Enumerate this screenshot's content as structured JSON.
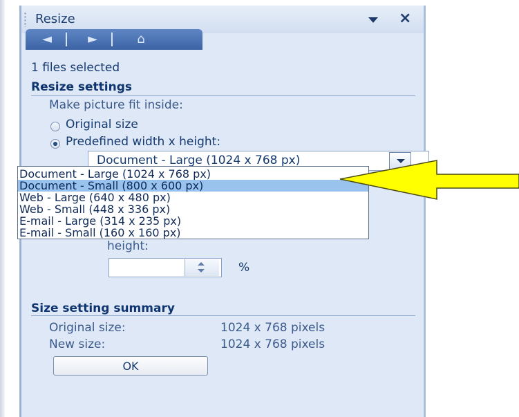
{
  "panel": {
    "title": "Resize",
    "nav_back_icon": "◄",
    "nav_forward_icon": "►",
    "nav_home_icon": "⌂"
  },
  "selection": {
    "status": "1 files selected"
  },
  "resize_settings": {
    "heading": "Resize settings",
    "fit_label": "Make picture fit inside:",
    "options": [
      {
        "label": "Original size",
        "selected": false
      },
      {
        "label": "Predefined width x height:",
        "selected": true
      }
    ],
    "combo_value": "Document - Large (1024 x 768 px)",
    "dropdown_items": [
      {
        "label": "Document - Large (1024 x 768 px)",
        "highlighted": false
      },
      {
        "label": "Document - Small (800 x 600 px)",
        "highlighted": true
      },
      {
        "label": "Web - Large (640 x 480 px)",
        "highlighted": false
      },
      {
        "label": "Web - Small (448 x 336 px)",
        "highlighted": false
      },
      {
        "label": "E-mail - Large (314 x 235 px)",
        "highlighted": false
      },
      {
        "label": "E-mail - Small (160 x 160 px)",
        "highlighted": false
      }
    ],
    "height_label": "height:",
    "height_value": "",
    "percent_unit": "%"
  },
  "summary": {
    "heading": "Size setting summary",
    "original_label": "Original size:",
    "original_value": "1024 x 768 pixels",
    "new_label": "New size:",
    "new_value": "1024 x 768 pixels"
  },
  "ok_label": "OK",
  "colors": {
    "panel_bg": "#dfe8f6",
    "heading": "#0f3570",
    "highlight": "#99c2ec",
    "arrow_fill": "#ffff00"
  }
}
